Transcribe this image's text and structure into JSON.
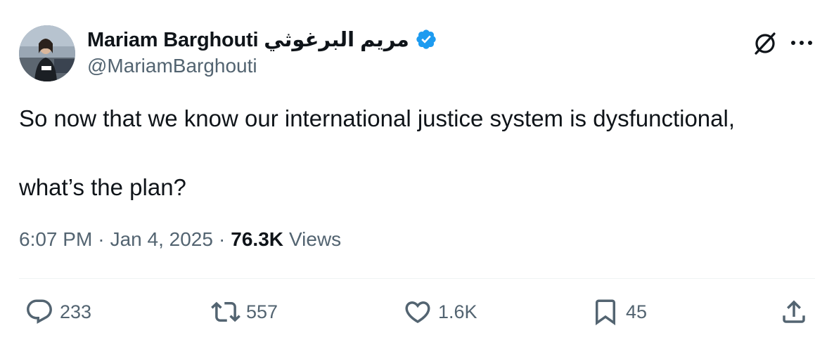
{
  "author": {
    "display_name": "Mariam Barghouti مريم البرغوثي",
    "handle": "@MariamBarghouti",
    "verified": true
  },
  "tweet": {
    "line1": "So now that we know our international justice system is dysfunctional,",
    "line2": "what’s the plan?"
  },
  "meta": {
    "time": "6:07 PM",
    "separator": "·",
    "date": "Jan 4, 2025",
    "views_count": "76.3K",
    "views_label": "Views"
  },
  "actions": {
    "replies": "233",
    "reposts": "557",
    "likes": "1.6K",
    "bookmarks": "45"
  },
  "icons": {
    "verified": "verified-badge-icon",
    "grok": "grok-icon",
    "more": "more-icon",
    "reply": "reply-icon",
    "repost": "repost-icon",
    "like": "heart-icon",
    "bookmark": "bookmark-icon",
    "share": "share-icon"
  },
  "colors": {
    "text": "#0f1419",
    "secondary": "#536471",
    "verified": "#1d9bf0",
    "divider": "#eff3f4"
  }
}
